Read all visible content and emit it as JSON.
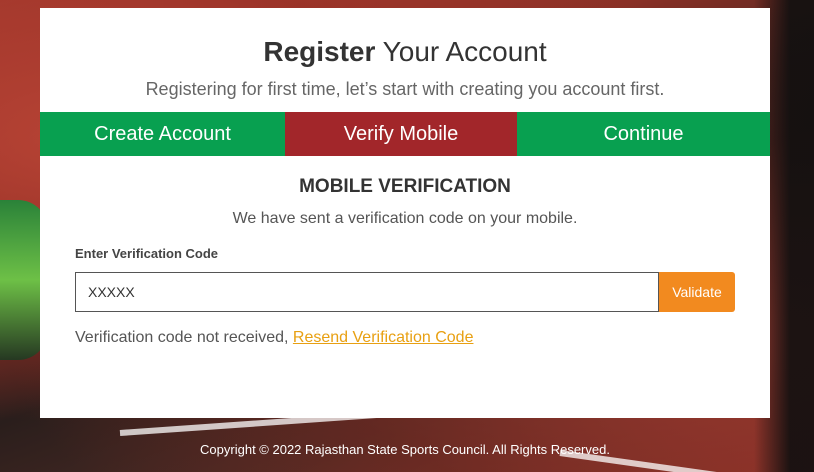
{
  "header": {
    "title_bold": "Register",
    "title_rest": " Your Account",
    "subtitle": "Registering for first time, let’s start with creating you account first."
  },
  "steps": [
    {
      "label": "Create Account",
      "color": "#08a050"
    },
    {
      "label": "Verify Mobile",
      "color": "#a2262a",
      "active": true
    },
    {
      "label": "Continue",
      "color": "#08a050"
    }
  ],
  "verification": {
    "heading": "MOBILE VERIFICATION",
    "description": "We have sent a verification code on your mobile.",
    "field_label": "Enter Verification Code",
    "input_placeholder": "XXXXX",
    "validate_label": "Validate",
    "not_received_text": "Verification code not received, ",
    "resend_label": "Resend Verification Code"
  },
  "footer": {
    "copyright": "Copyright © 2022 Rajasthan State Sports Council. All Rights Reserved."
  },
  "colors": {
    "accent_green": "#08a050",
    "active_red": "#a2262a",
    "validate_orange": "#f28a1f",
    "link_orange": "#e8a012"
  }
}
